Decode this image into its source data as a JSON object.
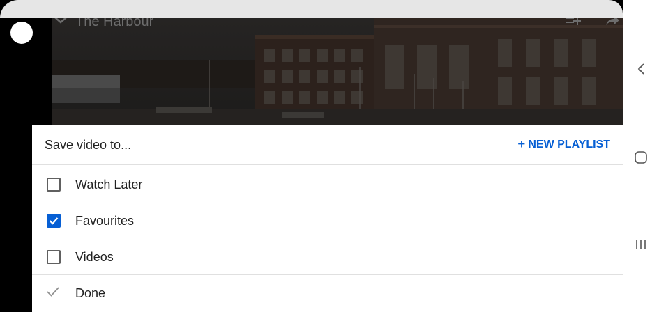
{
  "video": {
    "title": "The Harbour",
    "icons": [
      "chevron-down-icon",
      "add-to-queue-icon",
      "share-icon"
    ]
  },
  "sheet": {
    "title": "Save video to...",
    "new_playlist_label": "NEW PLAYLIST",
    "playlists": [
      {
        "label": "Watch Later",
        "checked": false
      },
      {
        "label": "Favourites",
        "checked": true
      },
      {
        "label": "Videos",
        "checked": false
      }
    ],
    "done_label": "Done"
  },
  "navbar": {
    "buttons": [
      "back-icon",
      "home-icon",
      "recent-apps-icon"
    ]
  },
  "colors": {
    "accent": "#065fd4",
    "text": "#212121",
    "divider": "#e0e0e0"
  }
}
